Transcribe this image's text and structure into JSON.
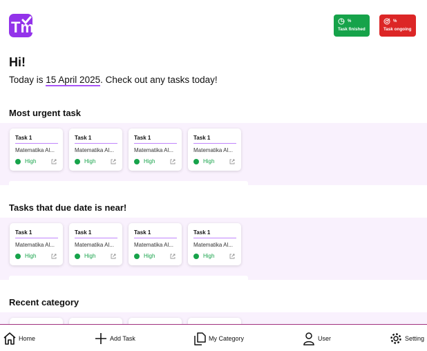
{
  "logo_text": "Tm",
  "stats": {
    "finished": {
      "value": "%",
      "label": "Task finished"
    },
    "ongoing": {
      "value": "%",
      "label": "Task ongoing"
    }
  },
  "greeting": "Hi!",
  "today": {
    "prefix": "Today is ",
    "date": "15 April 2025",
    "suffix": ". Check out any tasks today!"
  },
  "sections": {
    "urgent": {
      "title": "Most urgent task",
      "cards": [
        {
          "title": "Task 1",
          "subject": "Matematika Al...",
          "priority": "High"
        },
        {
          "title": "Task 1",
          "subject": "Matematika Al...",
          "priority": "High"
        },
        {
          "title": "Task 1",
          "subject": "Matematika Al...",
          "priority": "High"
        },
        {
          "title": "Task 1",
          "subject": "Matematika Al...",
          "priority": "High"
        }
      ]
    },
    "due": {
      "title": "Tasks that due date is near!",
      "cards": [
        {
          "title": "Task 1",
          "subject": "Matematika Al...",
          "priority": "High"
        },
        {
          "title": "Task 1",
          "subject": "Matematika Al...",
          "priority": "High"
        },
        {
          "title": "Task 1",
          "subject": "Matematika Al...",
          "priority": "High"
        },
        {
          "title": "Task 1",
          "subject": "Matematika Al...",
          "priority": "High"
        }
      ]
    },
    "recent": {
      "title": "Recent category"
    }
  },
  "nav": {
    "home": "Home",
    "add_task": "Add Task",
    "my_category": "My Category",
    "user": "User",
    "setting": "Setting"
  },
  "colors": {
    "accent": "#9333ea",
    "finished": "#16a34a",
    "ongoing": "#dc2626",
    "band": "#f9f1fd",
    "priority_high": "#16a34a"
  },
  "icons": {
    "home": "home-icon",
    "add": "plus-icon",
    "category": "copy-icon",
    "user": "user-icon",
    "setting": "gear-icon"
  }
}
